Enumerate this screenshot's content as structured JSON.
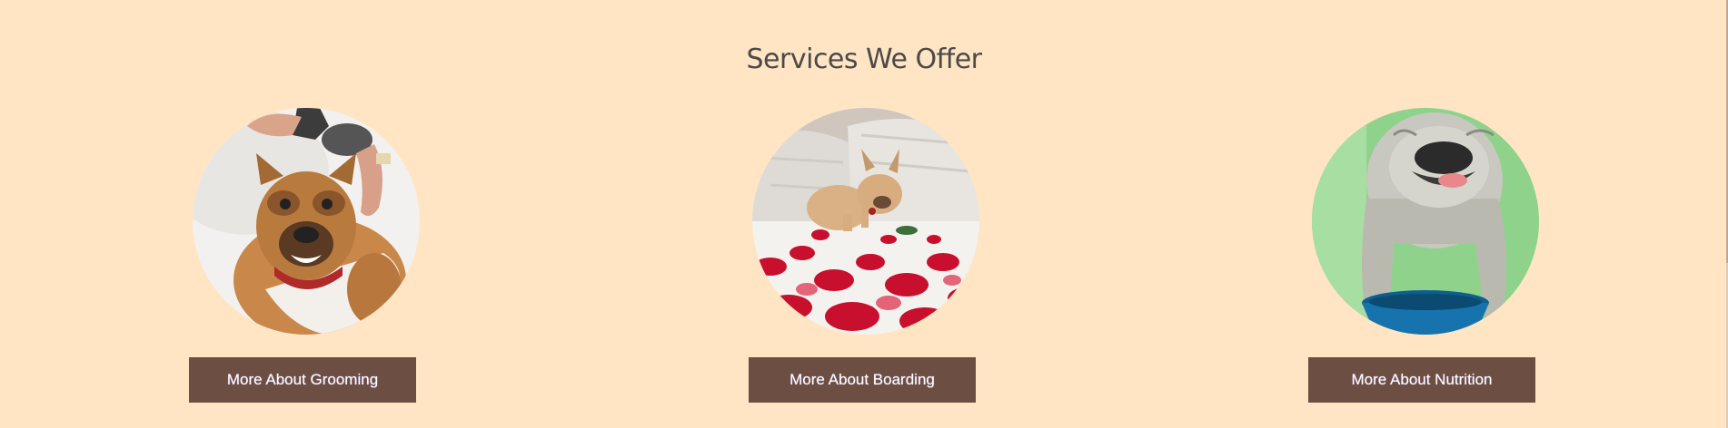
{
  "section": {
    "title": "Services We Offer"
  },
  "services": [
    {
      "button_label": "More About Grooming",
      "image_alt": "French bulldog being bathed"
    },
    {
      "button_label": "More About Boarding",
      "image_alt": "French bulldog puppy on bed with rose petals"
    },
    {
      "button_label": "More About Nutrition",
      "image_alt": "Bulldog eating from blue bowl"
    }
  ],
  "colors": {
    "background": "#FFE5C3",
    "button": "#6C4E42",
    "title_text": "#4a4a4a",
    "button_text": "#ffffff"
  }
}
